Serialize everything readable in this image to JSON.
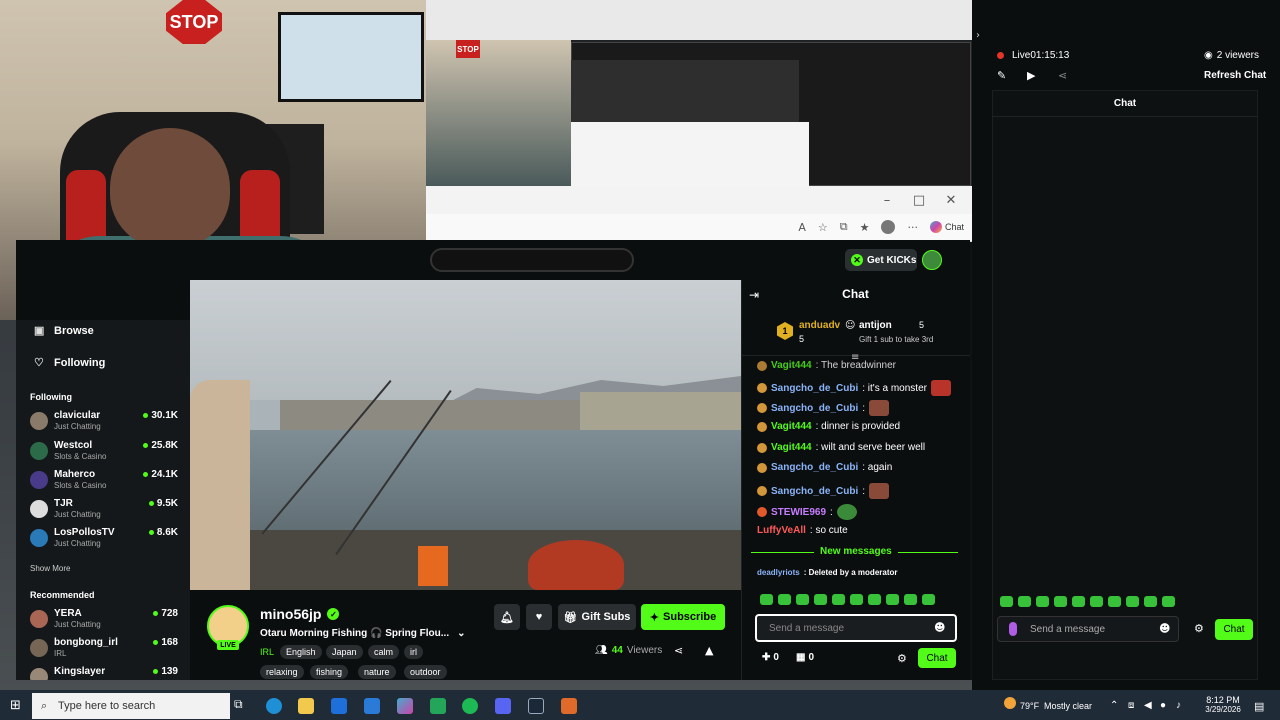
{
  "webcam": {
    "stop_sign": "STOP"
  },
  "mirror": {
    "stop_sign": "STOP"
  },
  "browser": {
    "chat_tab_label": "Chat",
    "get_kicks_label": "Get KICKs"
  },
  "sidebar": {
    "browse_label": "Browse",
    "following_nav_label": "Following",
    "following_title": "Following",
    "following": [
      {
        "name": "clavicular",
        "category": "Just Chatting",
        "viewers": "30.1K"
      },
      {
        "name": "Westcol",
        "category": "Slots & Casino",
        "viewers": "25.8K"
      },
      {
        "name": "Maherco",
        "category": "Slots & Casino",
        "viewers": "24.1K"
      },
      {
        "name": "TJR",
        "category": "Just Chatting",
        "viewers": "9.5K"
      },
      {
        "name": "LosPollosTV",
        "category": "Just Chatting",
        "viewers": "8.6K"
      }
    ],
    "show_more": "Show More",
    "recommended_title": "Recommended",
    "recommended": [
      {
        "name": "YERA",
        "category": "Just Chatting",
        "viewers": "728"
      },
      {
        "name": "bongbong_irl",
        "category": "IRL",
        "viewers": "168"
      },
      {
        "name": "Kingslayer",
        "category": "",
        "viewers": "139"
      }
    ]
  },
  "stream": {
    "streamer": "mino56jp",
    "live_badge": "LIVE",
    "title": "Otaru Morning Fishing 🎧 Spring Flou...",
    "tags_row1": [
      "IRL",
      "English",
      "Japan",
      "calm",
      "irl"
    ],
    "tags_row2": [
      "relaxing",
      "fishing",
      "nature",
      "outdoor"
    ],
    "gift_subs": "Gift Subs",
    "subscribe": "Subscribe",
    "viewers_count": "44",
    "viewers_label": "Viewers"
  },
  "chat": {
    "title": "Chat",
    "top_gifter_1": {
      "name": "anduadv",
      "count": "5"
    },
    "top_gifter_2": {
      "name": "antijon",
      "count": "5",
      "note": "Gift 1 sub to take 3rd"
    },
    "messages": [
      {
        "user": "Vagit444",
        "text": ": The breadwinner",
        "color": "#53fc18"
      },
      {
        "user": "Sangcho_de_Cubi",
        "text": ": it's a monster",
        "color": "#8ab4f8"
      },
      {
        "user": "Sangcho_de_Cubi",
        "text": ":",
        "color": "#8ab4f8"
      },
      {
        "user": "Vagit444",
        "text": ": dinner is provided",
        "color": "#53fc18"
      },
      {
        "user": "Vagit444",
        "text": ": wilt and serve beer well",
        "color": "#53fc18"
      },
      {
        "user": "Sangcho_de_Cubi",
        "text": ": again",
        "color": "#8ab4f8"
      },
      {
        "user": "Sangcho_de_Cubi",
        "text": ":",
        "color": "#8ab4f8"
      },
      {
        "user": "STEWIE969",
        "text": ":",
        "color": "#c77dff"
      },
      {
        "user": "LuffyVeAll",
        "text": ": so cute",
        "color": "#ff5a5a"
      }
    ],
    "new_messages": "New messages",
    "deleted": {
      "user": "deadlyriots",
      "text": ": Deleted by a moderator"
    },
    "input_placeholder": "Send a message",
    "kicks_count": "0",
    "subs_count": "0",
    "chat_button": "Chat"
  },
  "popout": {
    "live_label": "Live",
    "live_time": "01:15:13",
    "viewers": "2 viewers",
    "refresh_chat": "Refresh Chat",
    "chat_title": "Chat",
    "input_placeholder": "Send a message",
    "chat_button": "Chat"
  },
  "taskbar": {
    "search_placeholder": "Type here to search",
    "weather_temp": "79°F",
    "weather_desc": "Mostly clear",
    "time": "8:12 PM",
    "date": "3/29/2026"
  },
  "colors": {
    "kick_green": "#53fc18",
    "bg_dark": "#0b0e0f"
  }
}
